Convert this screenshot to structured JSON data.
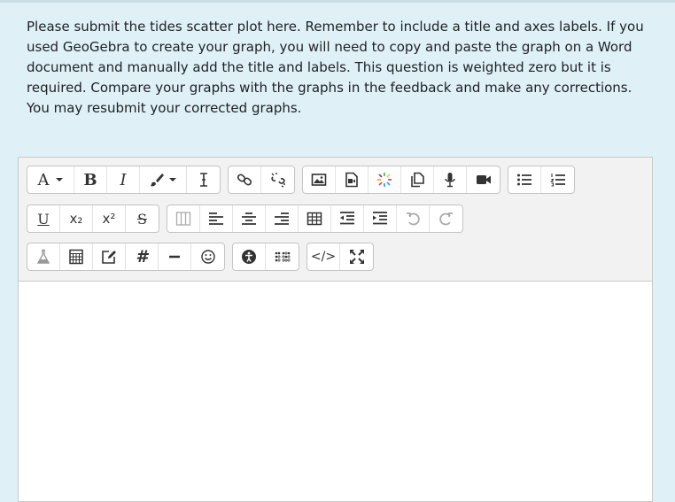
{
  "prompt": {
    "text": "Please submit the tides scatter plot here. Remember to include a title and axes labels. If you used GeoGebra to create your graph, you will need to copy and paste the graph on a Word document and manually add the title and labels. This question is weighted zero but it is required. Compare your graphs with the graphs in the feedback and make any corrections. You may resubmit your corrected graphs."
  },
  "toolbar": {
    "font_label": "A",
    "bold_label": "B",
    "italic_label": "I",
    "underline_label": "U",
    "subscript_label": "x₂",
    "superscript_label": "x²",
    "strikethrough_label": "S",
    "hash_label": "#",
    "code_label": "</>"
  },
  "colors": {
    "background": "#dff0f7",
    "toolbar": "#f2f2f2",
    "border": "#c8c8c8"
  }
}
